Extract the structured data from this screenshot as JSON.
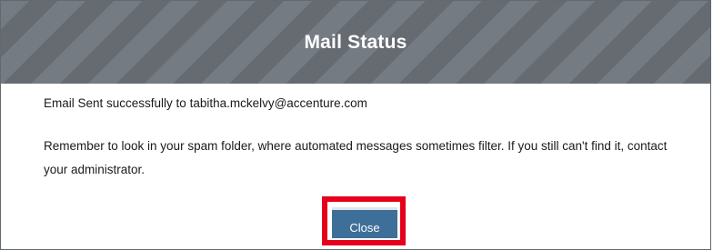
{
  "dialog": {
    "title": "Mail Status",
    "message_sent": "Email Sent successfully to tabitha.mckelvy@accenture.com",
    "message_note": "Remember to look in your spam folder, where automated messages sometimes filter. If you still can't find it, contact your administrator.",
    "close_label": "Close"
  },
  "colors": {
    "header_bg": "#6b7178",
    "button_bg": "#3e6f98",
    "highlight": "#e5001c"
  }
}
